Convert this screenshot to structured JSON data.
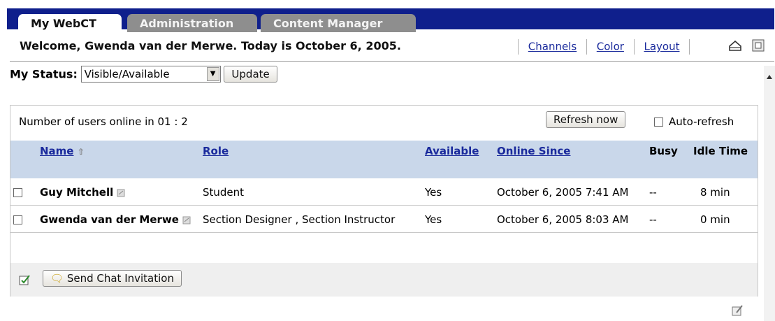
{
  "tabs": [
    {
      "label": "My WebCT",
      "active": true
    },
    {
      "label": "Administration",
      "active": false
    },
    {
      "label": "Content Manager",
      "active": false
    }
  ],
  "welcome": {
    "text": "Welcome, Gwenda van der Merwe. Today is October 6, 2005.",
    "links": [
      "Channels",
      "Color",
      "Layout"
    ],
    "icons": [
      "home-icon",
      "calendar-icon"
    ]
  },
  "status": {
    "label": "My Status:",
    "selected": "Visible/Available",
    "update_label": "Update"
  },
  "online": {
    "count_text": "Number of users online in 01 : 2",
    "refresh_label": "Refresh now",
    "auto_refresh_label": "Auto-refresh"
  },
  "table": {
    "columns": [
      "Name",
      "Role",
      "Available",
      "Online Since",
      "Busy",
      "Idle Time"
    ],
    "rows": [
      {
        "name": "Guy Mitchell",
        "role": "Student",
        "available": "Yes",
        "online_since": "October 6, 2005 7:41 AM",
        "busy": "--",
        "idle": "8 min"
      },
      {
        "name": "Gwenda van der Merwe",
        "role": "Section Designer , Section Instructor",
        "available": "Yes",
        "online_since": "October 6, 2005 8:03 AM",
        "busy": "--",
        "idle": "0 min"
      }
    ]
  },
  "actions": {
    "send_chat_label": "Send Chat Invitation"
  },
  "colors": {
    "tabbar": "#0f1f8c",
    "header_row": "#c9d7ea",
    "link": "#1a2a9c"
  }
}
